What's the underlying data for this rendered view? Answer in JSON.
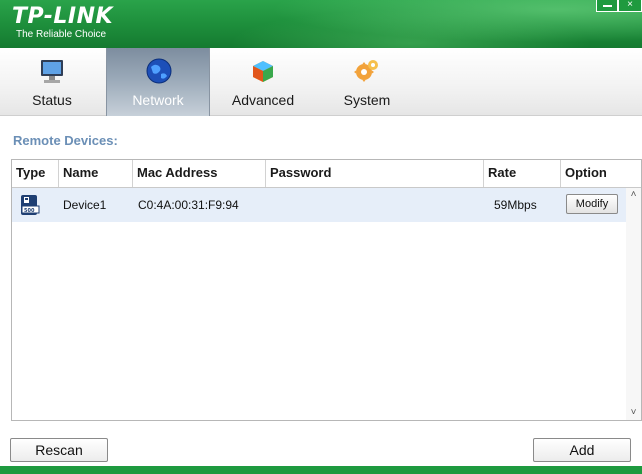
{
  "header": {
    "logo": "TP-LINK",
    "tagline": "The Reliable Choice",
    "close_glyph": "×"
  },
  "tabs": [
    {
      "label": "Status",
      "icon": "monitor-icon",
      "active": false
    },
    {
      "label": "Network",
      "icon": "globe-icon",
      "active": true
    },
    {
      "label": "Advanced",
      "icon": "cube-icon",
      "active": false
    },
    {
      "label": "System",
      "icon": "gear-icon",
      "active": false
    }
  ],
  "section": {
    "title": "Remote Devices:"
  },
  "table": {
    "columns": [
      "Type",
      "Name",
      "Mac Address",
      "Password",
      "Rate",
      "Option"
    ],
    "rows": [
      {
        "type_icon": "powerline-adapter-icon",
        "name": "Device1",
        "mac": "C0:4A:00:31:F9:94",
        "password": "",
        "rate": "59Mbps",
        "option": "Modify"
      }
    ]
  },
  "scroll": {
    "up": "˄",
    "down": "˅"
  },
  "buttons": {
    "rescan": "Rescan",
    "add": "Add"
  },
  "colors": {
    "brand_green": "#1e8f3c",
    "section_title": "#6b8fb6",
    "selected_row": "#e6eef9"
  }
}
